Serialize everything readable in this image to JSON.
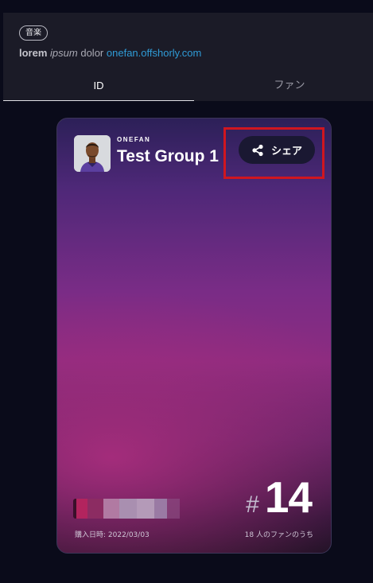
{
  "header": {
    "genre_tag": "音楽",
    "description": {
      "bold": "lorem",
      "italic": "ipsum",
      "plain": "dolor",
      "link": "onefan.offshorly.com"
    },
    "tabs": [
      {
        "label": "ID",
        "active": true
      },
      {
        "label": "ファン",
        "active": false
      }
    ]
  },
  "card": {
    "brand": "ONEFAN",
    "title": "Test Group 1",
    "share_label": "シェア",
    "purchase_date": "購入日時: 2022/03/03",
    "rank_symbol": "#",
    "rank": "14",
    "rank_caption": "18 人のファンのうち"
  },
  "colors": {
    "background": "#0a0b1a",
    "panel": "#1b1b27",
    "link": "#2f9bd6",
    "highlight": "#d0161f",
    "share_button": "#1a1832"
  },
  "icons": [
    "share-icon",
    "avatar-portrait"
  ]
}
